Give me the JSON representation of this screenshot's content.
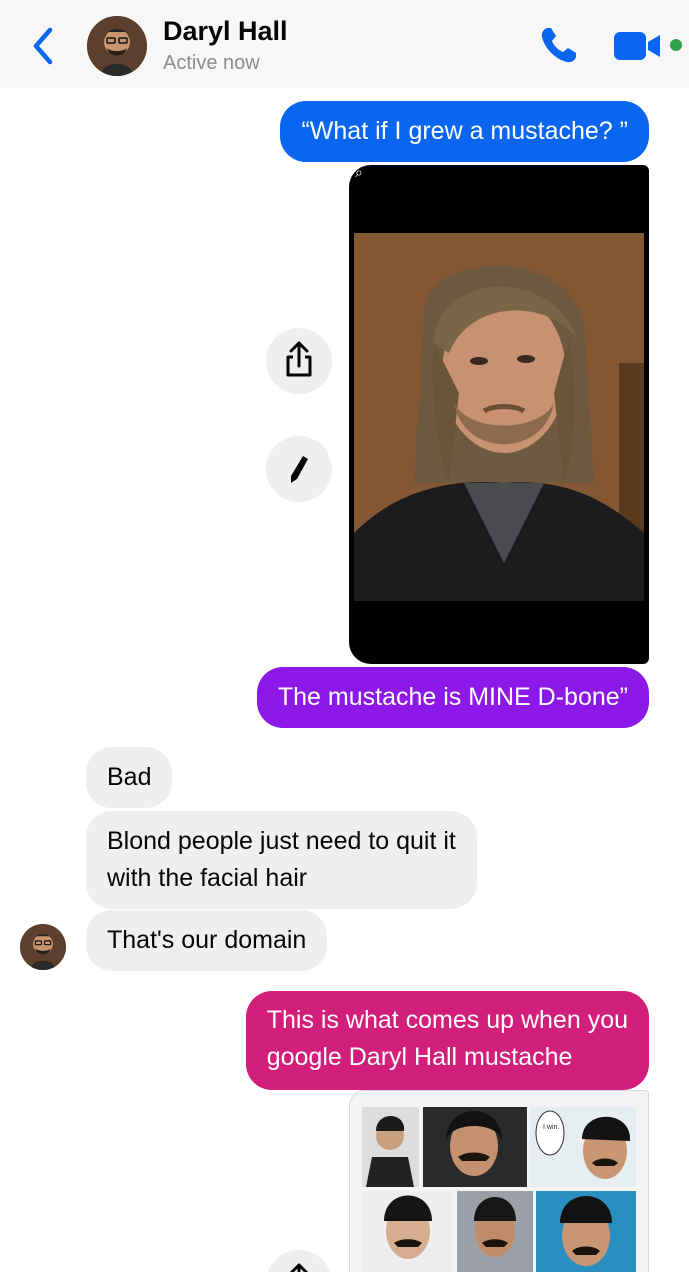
{
  "header": {
    "contact_name": "Daryl Hall",
    "status": "Active now",
    "icons": {
      "back": "chevron-left-icon",
      "call": "phone-icon",
      "video": "video-camera-icon"
    },
    "accent_color": "#0a66f0",
    "online_color": "#31a24c"
  },
  "messages": [
    {
      "direction": "outgoing",
      "type": "text",
      "text": "“What if I grew a mustache? ”",
      "color": "#0a66f0"
    },
    {
      "direction": "outgoing",
      "type": "image",
      "description": "photo"
    },
    {
      "direction": "outgoing",
      "type": "text",
      "text": "The mustache is MINE D-bone”",
      "color": "#8c19e8"
    },
    {
      "direction": "incoming",
      "type": "text",
      "text": "Bad"
    },
    {
      "direction": "incoming",
      "type": "text",
      "text": "Blond people just need to quit it with the facial hair",
      "lines": [
        "Blond people just need to quit it",
        "with the facial hair"
      ]
    },
    {
      "direction": "incoming",
      "type": "text",
      "text": "That's our domain"
    },
    {
      "direction": "outgoing",
      "type": "text",
      "text": "This is what comes up when you google Daryl Hall mustache",
      "lines": [
        "This is what comes up when you",
        "google Daryl Hall mustache"
      ],
      "color": "#d21f7b"
    },
    {
      "direction": "outgoing",
      "type": "image",
      "description": "image search collage"
    }
  ],
  "collage_caption": "I win.",
  "actions": {
    "share": "share-icon",
    "edit": "pencil-icon"
  }
}
